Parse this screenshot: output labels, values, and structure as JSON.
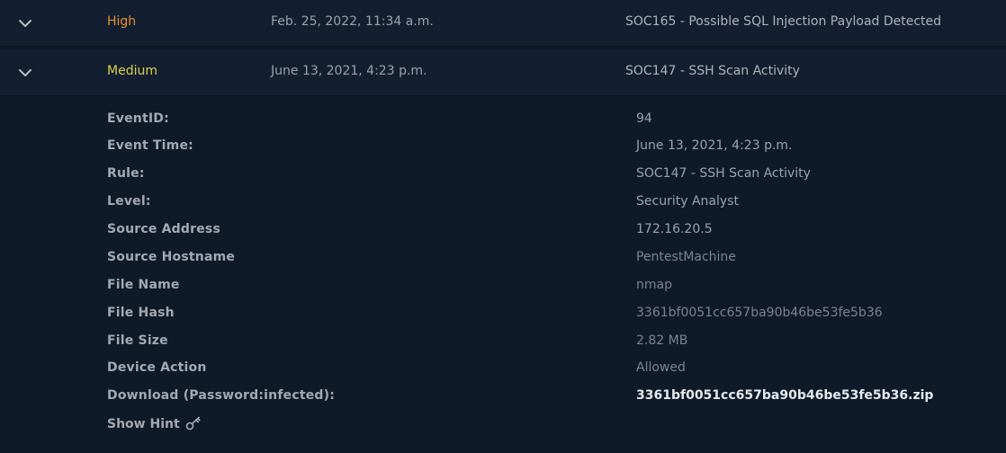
{
  "alerts": [
    {
      "severity": "High",
      "date": "Feb. 25, 2022, 11:34 a.m.",
      "rule": "SOC165 - Possible SQL Injection Payload Detected",
      "severity_color": "#e8902c",
      "icon": "chevron-down-icon"
    },
    {
      "severity": "Medium",
      "date": "June 13, 2021, 4:23 p.m.",
      "rule": "SOC147 - SSH Scan Activity",
      "severity_color": "#d9cf4a",
      "icon": "chevron-down-icon"
    }
  ],
  "details": [
    {
      "label": "EventID:",
      "value": "94"
    },
    {
      "label": "Event Time:",
      "value": "June 13, 2021, 4:23 p.m."
    },
    {
      "label": "Rule:",
      "value": "SOC147 - SSH Scan Activity"
    },
    {
      "label": "Level:",
      "value": "Security Analyst"
    },
    {
      "label": "Source Address",
      "value": "172.16.20.5"
    },
    {
      "label": "Source Hostname",
      "value": "PentestMachine"
    },
    {
      "label": "File Name",
      "value": "nmap"
    },
    {
      "label": "File Hash",
      "value": "3361bf0051cc657ba90b46be53fe5b36"
    },
    {
      "label": "File Size",
      "value": "2.82 MB"
    },
    {
      "label": "Device Action",
      "value": "Allowed"
    },
    {
      "label": "Download (Password:infected):",
      "value": "3361bf0051cc657ba90b46be53fe5b36.zip"
    }
  ],
  "hint": {
    "label": "Show Hint",
    "icon": "key-icon"
  }
}
